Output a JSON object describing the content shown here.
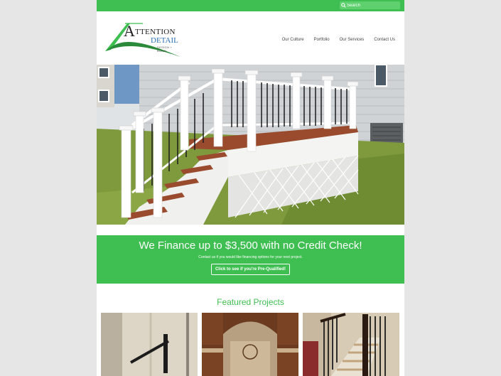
{
  "search": {
    "placeholder": "Search"
  },
  "logo": {
    "big_letter": "A",
    "line1": "TTENTION",
    "line2": "DETAIL",
    "tagline": "DESIGN + BUILD"
  },
  "nav": {
    "items": [
      "Our Culture",
      "Portfolio",
      "Our Services",
      "Contact Us"
    ]
  },
  "banner": {
    "headline": "We Finance up to $3,500 with no Credit Check!",
    "subtext": "Contact us if you would like financing options for your next project.",
    "cta": "Click to see if you're Pre-Qualified!"
  },
  "featured": {
    "title": "Featured Projects"
  },
  "colors": {
    "brand_green": "#3fbe52",
    "logo_blue": "#2d6fb7",
    "page_bg": "#e6e6e6"
  }
}
